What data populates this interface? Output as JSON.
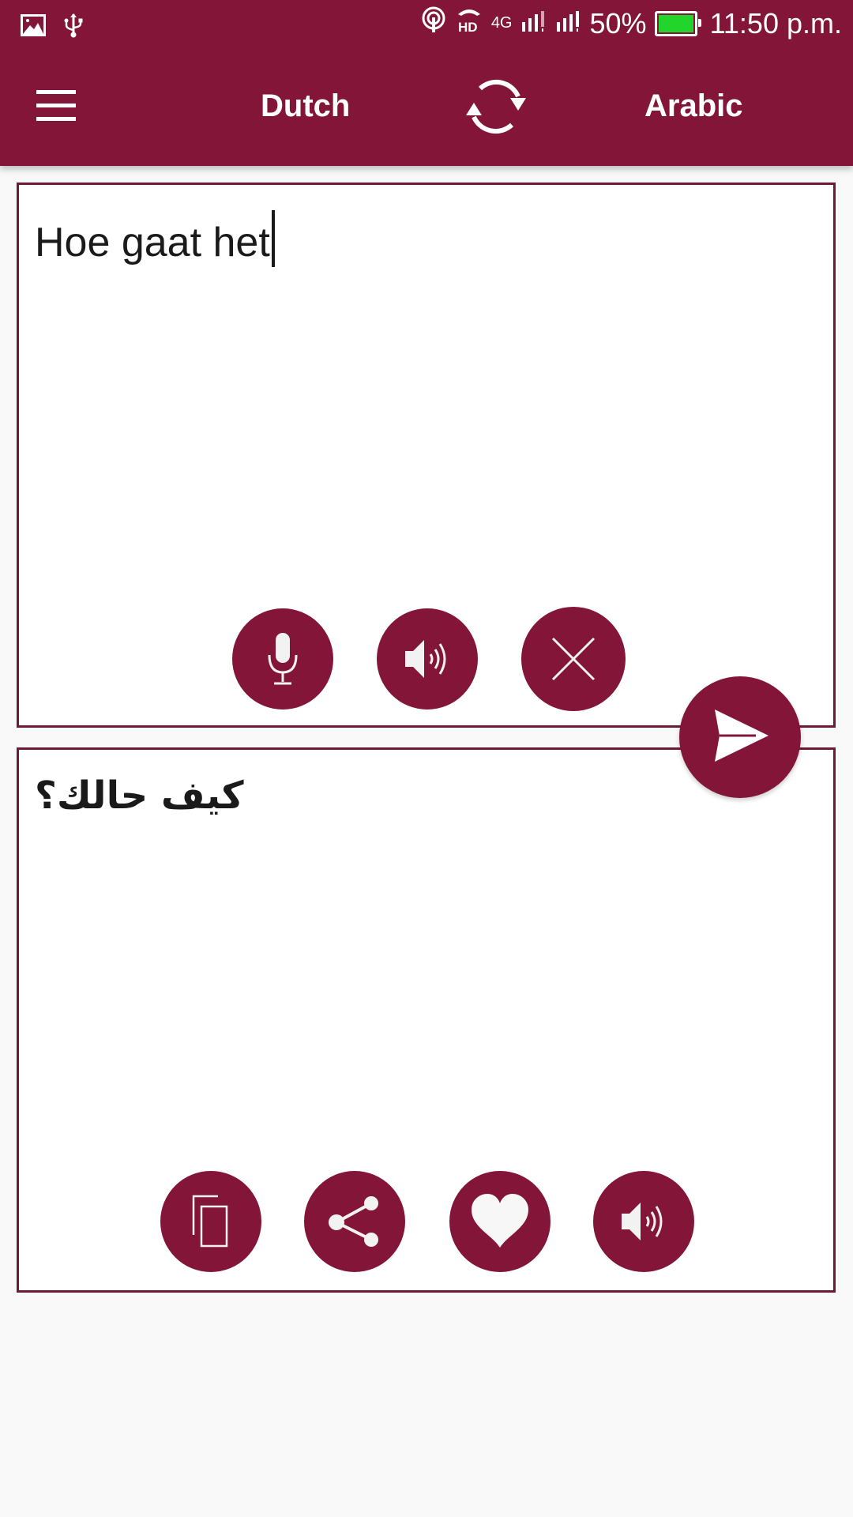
{
  "status_bar": {
    "left_icons": [
      "image-notification-icon",
      "usb-icon"
    ],
    "right_icons": [
      "hotspot-icon",
      "hd-voice-icon",
      "signal-sim1-icon",
      "signal-sim2-icon"
    ],
    "network_type": "4G",
    "battery_percent": "50%",
    "battery_level": 0.5,
    "battery_color": "#22d52a",
    "time": "11:50 p.m."
  },
  "toolbar": {
    "menu_icon": "hamburger-menu-icon",
    "source_language": "Dutch",
    "target_language": "Arabic",
    "swap_icon": "swap-languages-icon"
  },
  "input_panel": {
    "text": "Hoe gaat het",
    "buttons": [
      {
        "name": "voice-input-button",
        "icon": "microphone-icon"
      },
      {
        "name": "speak-input-button",
        "icon": "speaker-icon"
      },
      {
        "name": "clear-input-button",
        "icon": "close-icon"
      }
    ]
  },
  "translate_button": {
    "icon": "send-icon"
  },
  "output_panel": {
    "text": "كيف حالك؟",
    "buttons": [
      {
        "name": "copy-button",
        "icon": "copy-icon"
      },
      {
        "name": "share-button",
        "icon": "share-icon"
      },
      {
        "name": "favorite-button",
        "icon": "heart-icon"
      },
      {
        "name": "speak-output-button",
        "icon": "speaker-icon"
      }
    ]
  },
  "colors": {
    "primary": "#831638",
    "border": "#6e1a35",
    "background": "#f9f9f9"
  }
}
